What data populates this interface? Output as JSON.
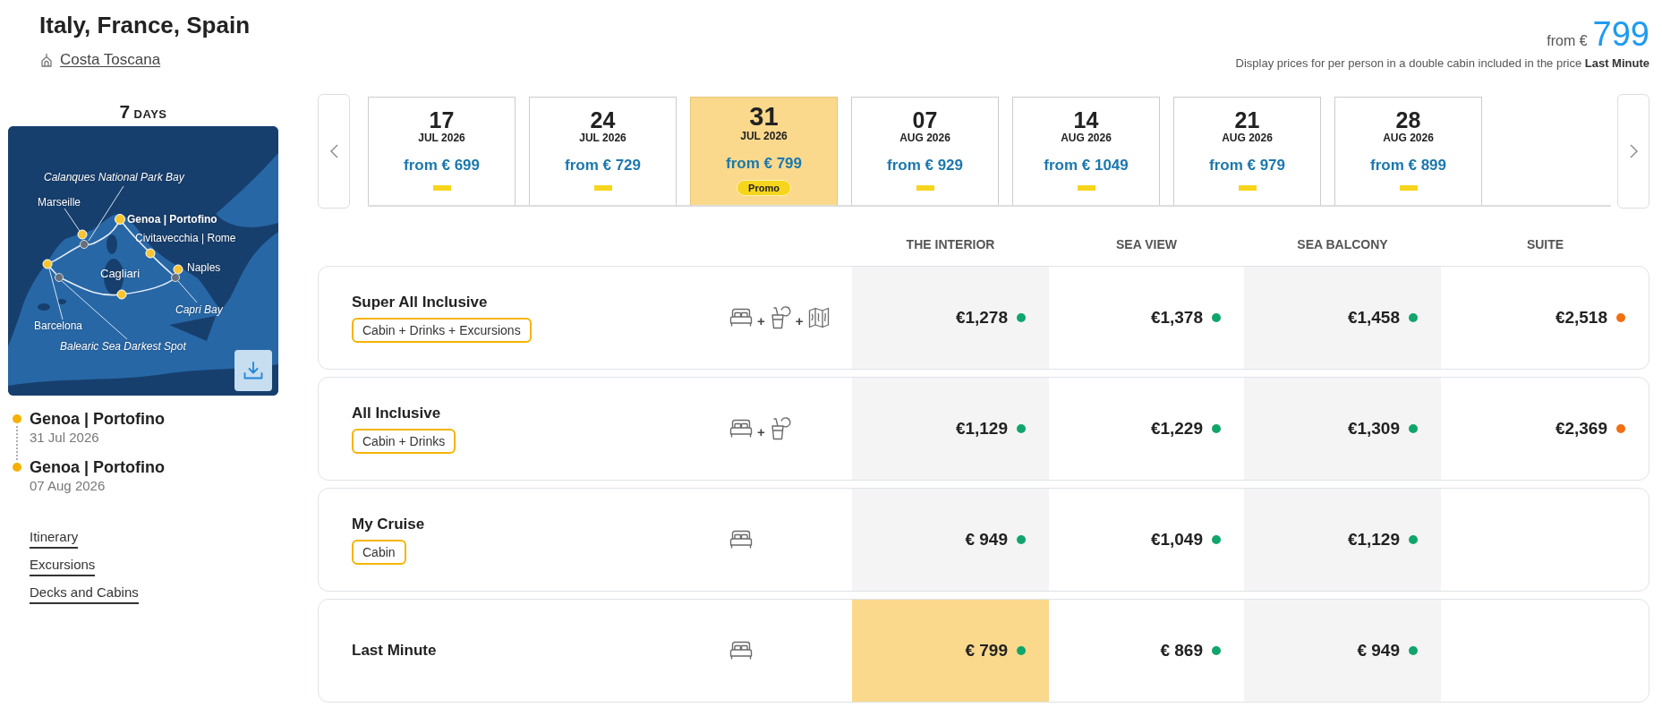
{
  "header": {
    "title": "Italy, France, Spain",
    "ship": "Costa Toscana",
    "price_prefix": "from €",
    "price": "799",
    "note": "Display prices for per person in a double cabin included in the price **Last Minute**"
  },
  "sidebar": {
    "duration": {
      "number": "7",
      "unit": "DAYS"
    },
    "map": {
      "labels": [
        {
          "text": "Calanques National Park Bay",
          "kind": "bay"
        },
        {
          "text": "Marseille",
          "kind": "port"
        },
        {
          "text": "Genoa | Portofino",
          "kind": "home"
        },
        {
          "text": "Civitavecchia | Rome",
          "kind": "port"
        },
        {
          "text": "Naples",
          "kind": "port"
        },
        {
          "text": "Cagliari",
          "kind": "port"
        },
        {
          "text": "Capri Bay",
          "kind": "bay"
        },
        {
          "text": "Barcelona",
          "kind": "port"
        },
        {
          "text": "Balearic Sea Darkest Spot",
          "kind": "bay"
        }
      ]
    },
    "itinerary": [
      {
        "port": "Genoa | Portofino",
        "date": "31 Jul 2026"
      },
      {
        "port": "Genoa | Portofino",
        "date": "07 Aug 2026"
      }
    ],
    "links": [
      "Itinerary",
      "Excursions",
      "Decks and Cabins"
    ]
  },
  "date_tabs": [
    {
      "day": "17",
      "month": "JUL 2026",
      "price": "from € 699",
      "selected": false
    },
    {
      "day": "24",
      "month": "JUL 2026",
      "price": "from € 729",
      "selected": false
    },
    {
      "day": "31",
      "month": "JUL 2026",
      "price": "from € 799",
      "selected": true,
      "badge": "Promo"
    },
    {
      "day": "07",
      "month": "AUG 2026",
      "price": "from € 929",
      "selected": false
    },
    {
      "day": "14",
      "month": "AUG 2026",
      "price": "from € 1049",
      "selected": false
    },
    {
      "day": "21",
      "month": "AUG 2026",
      "price": "from € 979",
      "selected": false
    },
    {
      "day": "28",
      "month": "AUG 2026",
      "price": "from € 899",
      "selected": false
    }
  ],
  "fare_table": {
    "columns": [
      "THE INTERIOR",
      "SEA VIEW",
      "SEA BALCONY",
      "SUITE"
    ],
    "rows": [
      {
        "name": "Super All Inclusive",
        "tag": "Cabin + Drinks + Excursions",
        "inclusions": [
          {
            "kind": "cabin"
          },
          {
            "kind": "drinks",
            "joiner": "+"
          },
          {
            "kind": "excursions",
            "joiner": "+"
          }
        ],
        "prices": [
          {
            "value": "€1,278",
            "color": "#10a56b",
            "selected": false
          },
          {
            "value": "€1,378",
            "color": "#10a56b",
            "selected": false
          },
          {
            "value": "€1,458",
            "color": "#10a56b",
            "selected": false
          },
          {
            "value": "€2,518",
            "color": "#f26e10",
            "selected": false
          }
        ]
      },
      {
        "name": "All Inclusive",
        "tag": "Cabin + Drinks",
        "inclusions": [
          {
            "kind": "cabin"
          },
          {
            "kind": "drinks",
            "joiner": "+"
          }
        ],
        "prices": [
          {
            "value": "€1,129",
            "color": "#10a56b",
            "selected": false
          },
          {
            "value": "€1,229",
            "color": "#10a56b",
            "selected": false
          },
          {
            "value": "€1,309",
            "color": "#10a56b",
            "selected": false
          },
          {
            "value": "€2,369",
            "color": "#f26e10",
            "selected": false
          }
        ]
      },
      {
        "name": "My Cruise",
        "tag": "Cabin",
        "inclusions": [
          {
            "kind": "cabin"
          }
        ],
        "prices": [
          {
            "value": "€ 949",
            "color": "#10a56b",
            "selected": false
          },
          {
            "value": "€1,049",
            "color": "#10a56b",
            "selected": false
          },
          {
            "value": "€1,129",
            "color": "#10a56b",
            "selected": false
          }
        ]
      },
      {
        "name": "Last Minute",
        "inclusions": [
          {
            "kind": "cabin"
          }
        ],
        "prices": [
          {
            "value": "€ 799",
            "color": "#10a56b",
            "selected": true
          },
          {
            "value": "€ 869",
            "color": "#10a56b",
            "selected": false
          },
          {
            "value": "€ 949",
            "color": "#10a56b",
            "selected": false
          }
        ]
      }
    ]
  }
}
